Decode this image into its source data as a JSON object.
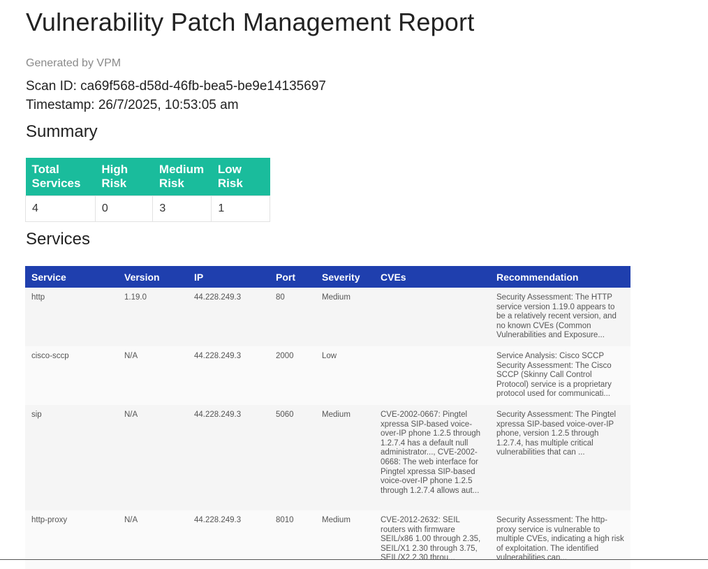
{
  "report": {
    "title": "Vulnerability Patch Management Report",
    "generated_by": "Generated by VPM",
    "scan_id": "Scan ID: ca69f568-d58d-46fb-bea5-be9e14135697",
    "timestamp": "Timestamp: 26/7/2025, 10:53:05 am"
  },
  "summary": {
    "heading": "Summary",
    "headers": [
      "Total Services",
      "High Risk",
      "Medium Risk",
      "Low Risk"
    ],
    "values": [
      "4",
      "0",
      "3",
      "1"
    ],
    "header_color": "#1abc9c"
  },
  "services": {
    "heading": "Services",
    "header_color": "#1f3fae",
    "headers": [
      "Service",
      "Version",
      "IP",
      "Port",
      "Severity",
      "CVEs",
      "Recommendation"
    ],
    "rows": [
      {
        "service": "http",
        "version": "1.19.0",
        "ip": "44.228.249.3",
        "port": "80",
        "severity": "Medium",
        "cves": "",
        "recommendation": "Security Assessment: The HTTP service version 1.19.0 appears to be a relatively recent version, and no known CVEs (Common Vulnerabilities and Exposure..."
      },
      {
        "service": "cisco-sccp",
        "version": "N/A",
        "ip": "44.228.249.3",
        "port": "2000",
        "severity": "Low",
        "cves": "",
        "recommendation": "Service Analysis: Cisco SCCP Security Assessment: The Cisco SCCP (Skinny Call Control Protocol) service is a proprietary protocol used for communicati..."
      },
      {
        "service": "sip",
        "version": "N/A",
        "ip": "44.228.249.3",
        "port": "5060",
        "severity": "Medium",
        "cves": "CVE-2002-0667: Pingtel xpressa SIP-based voice-over-IP phone 1.2.5 through 1.2.7.4 has a default null administrator..., CVE-2002-0668: The web interface for Pingtel xpressa SIP-based voice-over-IP phone 1.2.5 through 1.2.7.4 allows aut...",
        "recommendation": "Security Assessment: The Pingtel xpressa SIP-based voice-over-IP phone, version 1.2.5 through 1.2.7.4, has multiple critical vulnerabilities that can ..."
      },
      {
        "service": "http-proxy",
        "version": "N/A",
        "ip": "44.228.249.3",
        "port": "8010",
        "severity": "Medium",
        "cves": "CVE-2012-2632: SEIL routers with firmware SEIL/x86 1.00 through 2.35, SEIL/X1 2.30 through 3.75, SEIL/X2 2.30 throu...",
        "recommendation": "Security Assessment: The http-proxy service is vulnerable to multiple CVEs, indicating a high risk of exploitation. The identified vulnerabilities can..."
      }
    ]
  }
}
